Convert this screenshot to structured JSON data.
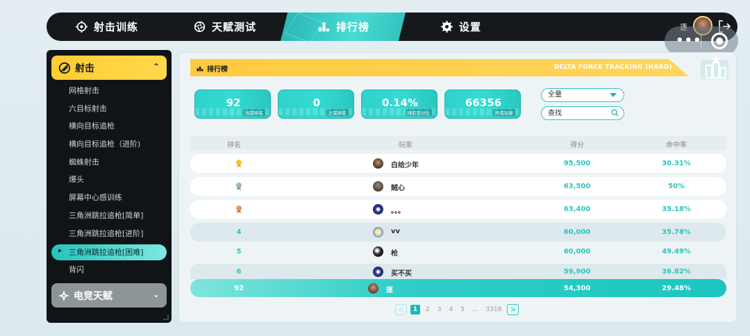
{
  "nav": {
    "tabs": [
      {
        "label": "射击训练",
        "icon": "crosshair-icon"
      },
      {
        "label": "天赋测试",
        "icon": "aperture-icon"
      },
      {
        "label": "排行榜",
        "icon": "podium-icon"
      },
      {
        "label": "设置",
        "icon": "gear-icon"
      }
    ],
    "active_tab": "排行榜",
    "user_name": "逐",
    "capsule_menu": "•••"
  },
  "sidebar": {
    "category_shoot": "射击",
    "category_talent": "电竞天赋",
    "items": [
      "网格射击",
      "六目标射击",
      "横向目标追枪",
      "横向目标追枪（进阶)",
      "蜘蛛射击",
      "爆头",
      "屏幕中心感训练",
      "三角洲跳拉追枪[简单]",
      "三角洲跳拉追枪[进阶]",
      "三角洲跳拉追枪[困难]",
      "背闪"
    ],
    "active_item": "三角洲跳拉追枪[困难]"
  },
  "leaderboard": {
    "title": "排行榜",
    "mode": "DELTA FORCE TRACKING (HARD)",
    "stats": [
      {
        "value": "92",
        "label": "当前排名"
      },
      {
        "value": "0",
        "label": "之前排名"
      },
      {
        "value": "0.14%",
        "label": "排名百分比"
      },
      {
        "value": "66356",
        "label": "所有玩家"
      }
    ],
    "filter_value": "全量",
    "search_placeholder": "查找",
    "columns": [
      "排名",
      "玩家",
      "得分",
      "命中率"
    ],
    "rows": [
      {
        "rank": "1",
        "medal": "gold",
        "player": "白给少年",
        "score": "95,500",
        "accuracy": "30.31%"
      },
      {
        "rank": "2",
        "medal": "silver",
        "player": "贼心",
        "score": "63,500",
        "accuracy": "50%"
      },
      {
        "rank": "3",
        "medal": "bronze",
        "player": "。。。",
        "score": "63,400",
        "accuracy": "35.18%"
      },
      {
        "rank": "4",
        "player": "vv",
        "score": "60,000",
        "accuracy": "35.78%"
      },
      {
        "rank": "5",
        "player": "枪",
        "score": "60,000",
        "accuracy": "49.49%"
      },
      {
        "rank": "6",
        "player": "买不买",
        "score": "59,900",
        "accuracy": "36.82%"
      }
    ],
    "my_row": {
      "rank": "92",
      "player": "逐",
      "score": "54,300",
      "accuracy": "29.48%"
    },
    "pagination": {
      "prev": "<",
      "pages": [
        "1",
        "2",
        "3",
        "4",
        "5"
      ],
      "ellipsis": "...",
      "last": "3318",
      "next": ">",
      "current": "1"
    }
  },
  "colors": {
    "accent": "#2bc6c0",
    "gold": "#ffcb3e",
    "dark": "#15191c"
  }
}
